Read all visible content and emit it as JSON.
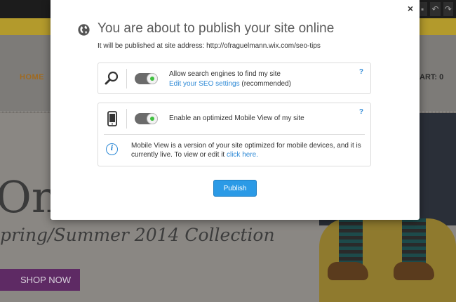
{
  "background": {
    "nav": {
      "home": "HOME",
      "cart": "ART: 0"
    },
    "hero": {
      "headline": "Onli",
      "collection": "pring/Summer 2014 Collection",
      "shop_button": "SHOP NOW"
    },
    "toolbar_icons": [
      "square-icon",
      "undo-icon",
      "redo-icon"
    ]
  },
  "modal": {
    "close_label": "×",
    "title": "You are about to publish your site online",
    "subtitle": "It will be published at site address: http://ofraguelmann.wix.com/seo-tips",
    "seo": {
      "icon": "magnifier-icon",
      "toggle_on": true,
      "label": "Allow search engines to find my site",
      "link": "Edit your SEO settings",
      "link_suffix": " (recommended)",
      "help": "?"
    },
    "mobile": {
      "icon": "mobile-phone-icon",
      "toggle_on": true,
      "label": "Enable an optimized Mobile View of my site",
      "help": "?",
      "info_text": "Mobile View is a version of your site optimized for mobile devices, and it is currently live. To view or edit it ",
      "info_link": "click here."
    },
    "publish_button": "Publish"
  },
  "colors": {
    "accent": "#2b9ae6",
    "link": "#2f8ad6",
    "toggle_on_dot": "#3fbf3f"
  }
}
